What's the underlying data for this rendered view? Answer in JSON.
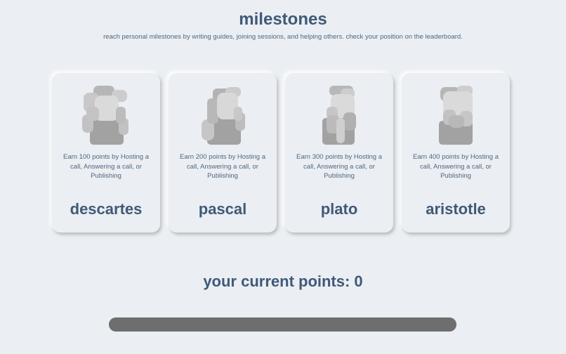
{
  "header": {
    "title": "milestones",
    "subtitle": "reach personal milestones by writing guides, joining sessions, and helping others. check your position on the leaderboard."
  },
  "milestones": [
    {
      "name": "descartes",
      "description": "Earn 100 points by Hosting a call, Answering a call, or Publishing",
      "icon": "bust-descartes-icon"
    },
    {
      "name": "pascal",
      "description": "Earn 200 points by Hosting a call, Answering a call, or Publishing",
      "icon": "bust-pascal-icon"
    },
    {
      "name": "plato",
      "description": "Earn 300 points by Hosting a call, Answering a call, or Publishing",
      "icon": "bust-plato-icon"
    },
    {
      "name": "aristotle",
      "description": "Earn 400 points by Hosting a call, Answering a call, or Publishing",
      "icon": "bust-aristotle-icon"
    }
  ],
  "points": {
    "label": "your current points: 0",
    "progress_fraction": 0
  },
  "colors": {
    "background": "#ebeef2",
    "heading": "#3f5a78",
    "progress_track": "#6e6e6e"
  }
}
